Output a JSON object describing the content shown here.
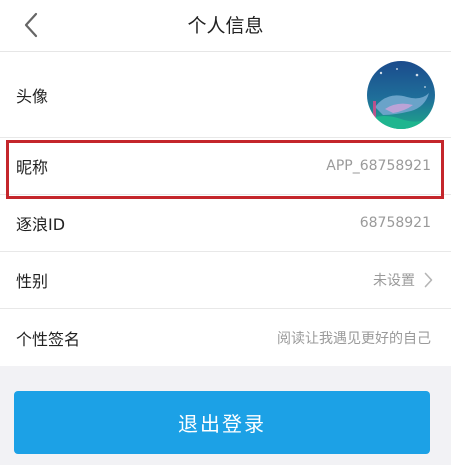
{
  "header": {
    "back_icon": "chevron-left-icon",
    "title": "个人信息"
  },
  "rows": [
    {
      "label": "头像",
      "value": ""
    },
    {
      "label": "昵称",
      "value": "APP_68758921"
    },
    {
      "label": "逐浪ID",
      "value": "68758921"
    },
    {
      "label": "性别",
      "value": "未设置",
      "icon": "chevron-right-icon"
    },
    {
      "label": "个性签名",
      "value": "阅读让我遇见更好的自己"
    }
  ],
  "logout_label": "退出登录",
  "colors": {
    "accent": "#1ca1e6",
    "highlight": "#c4262b",
    "background": "#f2f2f5"
  }
}
